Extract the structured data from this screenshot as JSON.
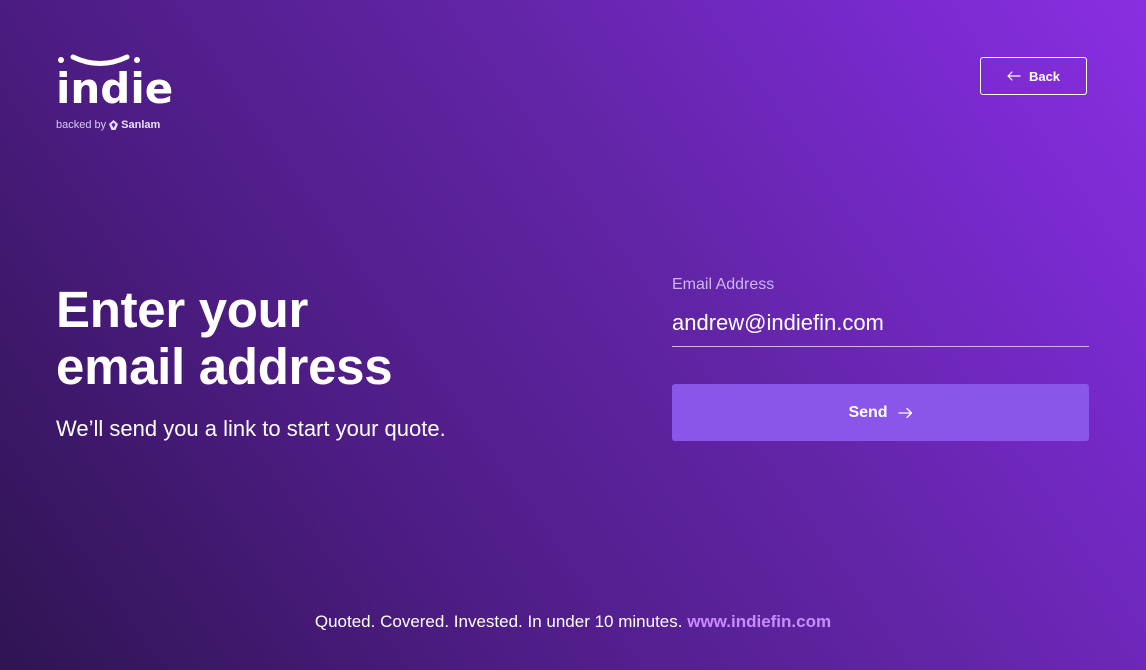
{
  "brand": {
    "name": "indie",
    "backed_by_prefix": "backed by",
    "backed_by_name": "Sanlam"
  },
  "header": {
    "back_label": "Back"
  },
  "main": {
    "heading_line1": "Enter your",
    "heading_line2": "email address",
    "subtext": "We’ll send you a link to start your quote."
  },
  "form": {
    "email_label": "Email Address",
    "email_value": "andrew@indiefin.com",
    "send_label": "Send"
  },
  "footer": {
    "tagline": "Quoted. Covered. Invested. In under 10 minutes.",
    "link_text": "www.indiefin.com"
  },
  "colors": {
    "button_purple": "#8a55e9",
    "link_purple": "#c98cff",
    "background_start": "#2f1452",
    "background_end": "#8a2fe0"
  },
  "icons": {
    "back": "arrow-left-icon",
    "send": "arrow-right-icon",
    "sanlam": "sanlam-logo-icon"
  }
}
